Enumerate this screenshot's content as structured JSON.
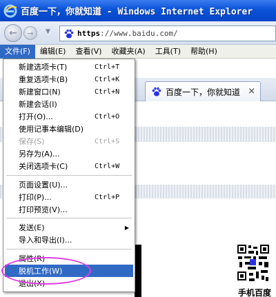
{
  "window": {
    "title": "百度一下，你就知道 - Windows Internet Explorer"
  },
  "navbar": {
    "address_scheme": "https",
    "address_rest": "://www.baidu.com/",
    "back_icon": "back-arrow-icon",
    "forward_icon": "forward-arrow-icon"
  },
  "menubar": {
    "items": [
      {
        "label": "文件(F)"
      },
      {
        "label": "编辑(E)"
      },
      {
        "label": "查看(V)"
      },
      {
        "label": "收藏夹(A)"
      },
      {
        "label": "工具(T)"
      },
      {
        "label": "帮助(H)"
      }
    ]
  },
  "tab": {
    "label": "百度一下，你就知道",
    "close": "×"
  },
  "file_menu": {
    "items": [
      {
        "label": "新建选项卡(T)",
        "shortcut": "Ctrl+T"
      },
      {
        "label": "重复选项卡(B)",
        "shortcut": "Ctrl+K"
      },
      {
        "label": "新建窗口(N)",
        "shortcut": "Ctrl+N"
      },
      {
        "label": "新建会话(I)",
        "shortcut": ""
      },
      {
        "label": "打开(O)...",
        "shortcut": "Ctrl+O"
      },
      {
        "label": "使用记事本编辑(D)",
        "shortcut": ""
      },
      {
        "label": "保存(S)",
        "shortcut": "Ctrl+S",
        "disabled": true
      },
      {
        "label": "另存为(A)...",
        "shortcut": ""
      },
      {
        "label": "关闭选项卡(C)",
        "shortcut": "Ctrl+W"
      },
      {
        "label": "页面设置(U)...",
        "shortcut": ""
      },
      {
        "label": "打印(P)...",
        "shortcut": "Ctrl+P"
      },
      {
        "label": "打印预览(V)...",
        "shortcut": ""
      },
      {
        "label": "发送(E)",
        "shortcut": "",
        "submenu": true
      },
      {
        "label": "导入和导出(I)...",
        "shortcut": ""
      },
      {
        "label": "属性(R)",
        "shortcut": ""
      },
      {
        "label": "脱机工作(W)",
        "shortcut": "",
        "highlighted": true
      },
      {
        "label": "退出(X)",
        "shortcut": ""
      }
    ]
  },
  "page": {
    "qr_caption": "手机百度"
  },
  "colors": {
    "titlebar": "#0a53d8",
    "menu_highlight": "#316ac5",
    "annotation": "#e03ce8"
  }
}
